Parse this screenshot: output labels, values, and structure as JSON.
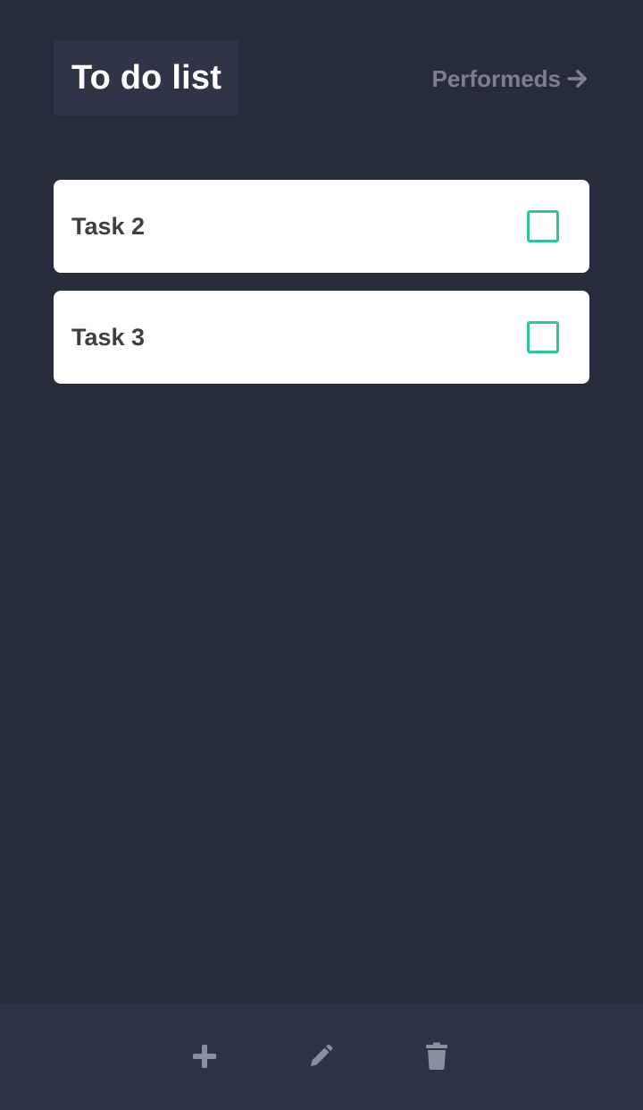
{
  "header": {
    "title": "To do list",
    "performeds_label": "Performeds",
    "performeds_icon": "arrow-right-icon"
  },
  "tasks": [
    {
      "label": "Task 2",
      "checked": false
    },
    {
      "label": "Task 3",
      "checked": false
    }
  ],
  "toolbar": {
    "add_icon": "plus-icon",
    "edit_icon": "pencil-icon",
    "delete_icon": "trash-icon"
  },
  "colors": {
    "background": "#272c3d",
    "title_box": "#2f3447",
    "bottom_bar": "#2d3244",
    "accent": "#2fc4a0",
    "muted": "#7b7f8f",
    "task_text": "#3d3f45"
  }
}
